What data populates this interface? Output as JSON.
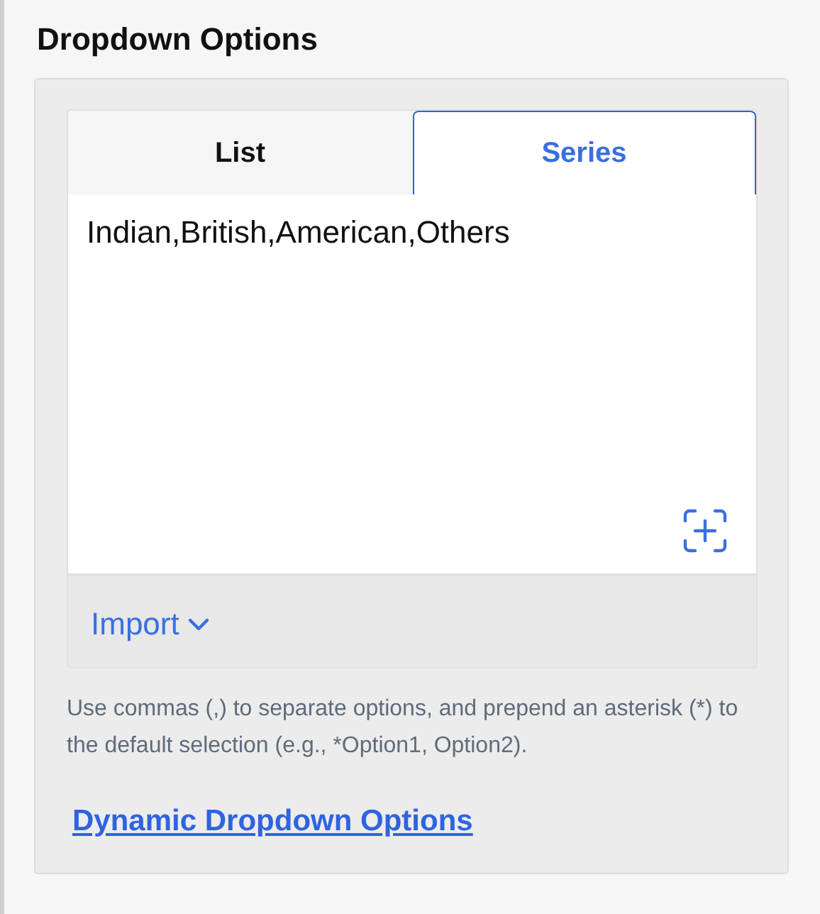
{
  "section_title": "Dropdown Options",
  "tabs": [
    {
      "label": "List",
      "selected": false
    },
    {
      "label": "Series",
      "selected": true
    }
  ],
  "options_field": {
    "value": "Indian,British,American,Others"
  },
  "import_button": {
    "label": "Import"
  },
  "help_text": "Use commas (,) to separate options, and prepend an asterisk (*) to the default selection (e.g., *Option1, Option2).",
  "link": "Dynamic Dropdown Options"
}
